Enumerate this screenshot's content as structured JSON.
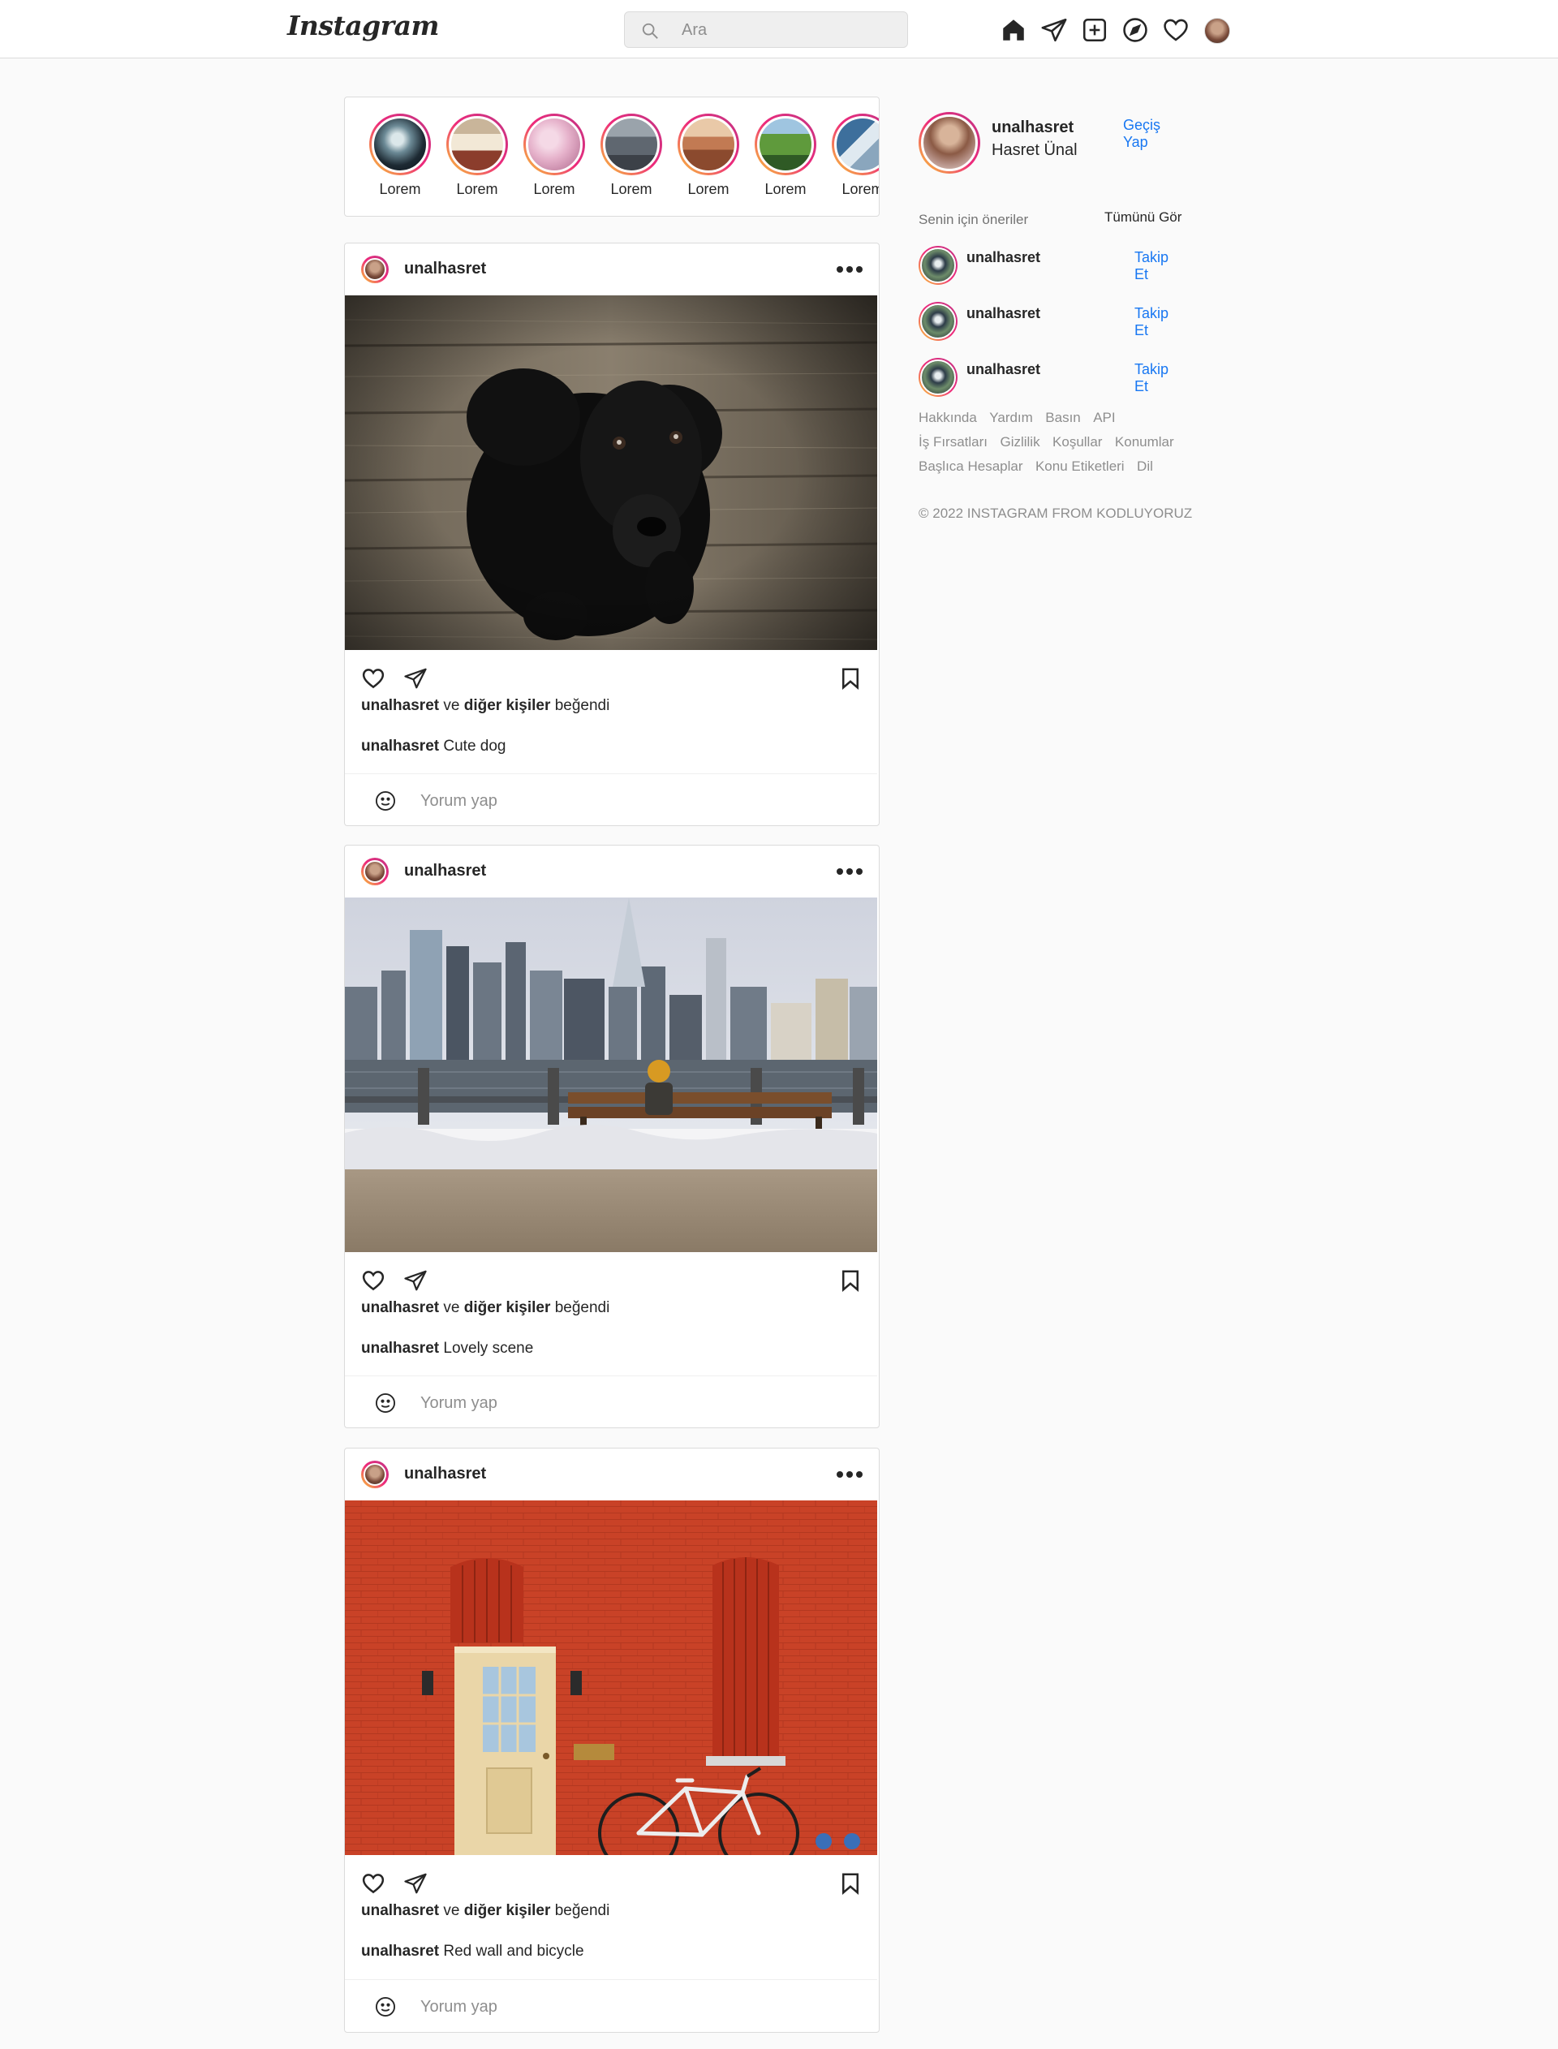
{
  "nav": {
    "logo": "Instagram",
    "search_placeholder": "Ara",
    "icons": [
      "home-icon",
      "direct-message-icon",
      "new-post-icon",
      "explore-icon",
      "activity-heart-icon",
      "profile-avatar"
    ]
  },
  "stories": [
    {
      "label": "Lorem"
    },
    {
      "label": "Lorem"
    },
    {
      "label": "Lorem"
    },
    {
      "label": "Lorem"
    },
    {
      "label": "Lorem"
    },
    {
      "label": "Lorem"
    },
    {
      "label": "Lorem"
    }
  ],
  "posts": [
    {
      "username": "unalhasret",
      "likes": {
        "user": "unalhasret",
        "and": "ve",
        "others": "diğer kişiler",
        "suffix": "beğendi"
      },
      "caption_user": "unalhasret",
      "caption": "Cute dog",
      "comment_placeholder": "Yorum yap"
    },
    {
      "username": "unalhasret",
      "likes": {
        "user": "unalhasret",
        "and": "ve",
        "others": "diğer kişiler",
        "suffix": "beğendi"
      },
      "caption_user": "unalhasret",
      "caption": "Lovely scene",
      "comment_placeholder": "Yorum yap"
    },
    {
      "username": "unalhasret",
      "likes": {
        "user": "unalhasret",
        "and": "ve",
        "others": "diğer kişiler",
        "suffix": "beğendi"
      },
      "caption_user": "unalhasret",
      "caption": "Red wall and bicycle",
      "comment_placeholder": "Yorum yap"
    }
  ],
  "sidebar": {
    "username": "unalhasret",
    "full_name": "Hasret Ünal",
    "switch_label": "Geçiş Yap",
    "suggestions_title": "Senin için öneriler",
    "see_all": "Tümünü Gör",
    "suggestions": [
      {
        "username": "unalhasret",
        "follow": "Takip Et"
      },
      {
        "username": "unalhasret",
        "follow": "Takip Et"
      },
      {
        "username": "unalhasret",
        "follow": "Takip Et"
      }
    ],
    "footer_rows": [
      [
        "Hakkında",
        "Yardım",
        "Basın",
        "API"
      ],
      [
        "İş Fırsatları",
        "Gizlilik",
        "Koşullar",
        "Konumlar"
      ],
      [
        "Başlıca Hesaplar",
        "Konu Etiketleri",
        "Dil"
      ]
    ],
    "copyright": "© 2022 INSTAGRAM FROM KODLUYORUZ"
  },
  "colors": {
    "link_blue": "#1877f2",
    "background": "#fafafa",
    "border": "#dbdbdb",
    "story_ring": [
      "#f9ce34",
      "#ee2a7b",
      "#c13584"
    ]
  }
}
